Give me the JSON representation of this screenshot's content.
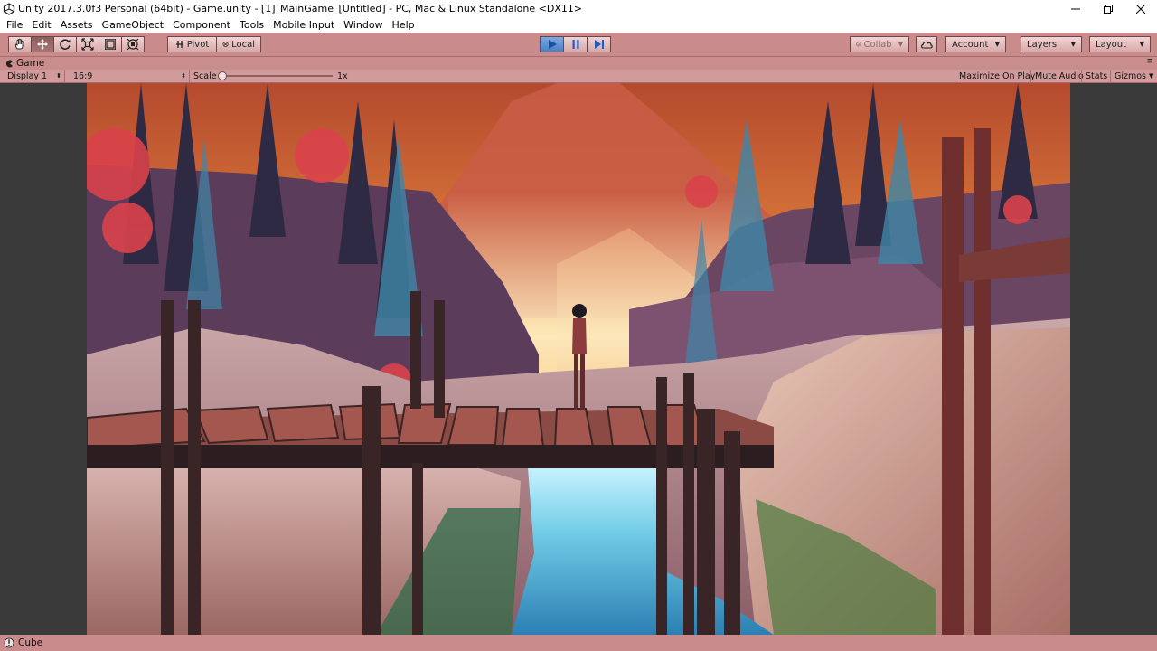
{
  "window": {
    "title": "Unity 2017.3.0f3 Personal (64bit) - Game.unity - [1]_MainGame_[Untitled] - PC, Mac & Linux Standalone <DX11>",
    "controls": [
      "minimize-icon",
      "restore-icon",
      "close-icon"
    ]
  },
  "menu": [
    "File",
    "Edit",
    "Assets",
    "GameObject",
    "Component",
    "Tools",
    "Mobile Input",
    "Window",
    "Help"
  ],
  "toolbar": {
    "tools": [
      "hand-icon",
      "move-icon",
      "rotate-icon",
      "scale-icon",
      "rect-tool-icon",
      "transform-icon"
    ],
    "pivot_label": "Pivot",
    "local_label": "Local",
    "play_icon": "play-icon",
    "pause_icon": "pause-icon",
    "step_icon": "step-icon",
    "collab_label": "Collab",
    "account_label": "Account",
    "layers_label": "Layers",
    "layout_label": "Layout"
  },
  "game_tab": {
    "label": "Game",
    "display": "Display 1",
    "aspect": "16:9",
    "scale_label": "Scale",
    "scale_value": "1x",
    "maximize_on_play": "Maximize On Play",
    "mute_audio": "Mute Audio",
    "stats": "Stats",
    "gizmos": "Gizmos"
  },
  "status": {
    "message": "Cube"
  },
  "colors": {
    "editor_tint": "#c98b8b",
    "play_active": "#4b7fc4",
    "scene_sky": "#f0a24c",
    "scene_water": "#7fd3ea"
  }
}
